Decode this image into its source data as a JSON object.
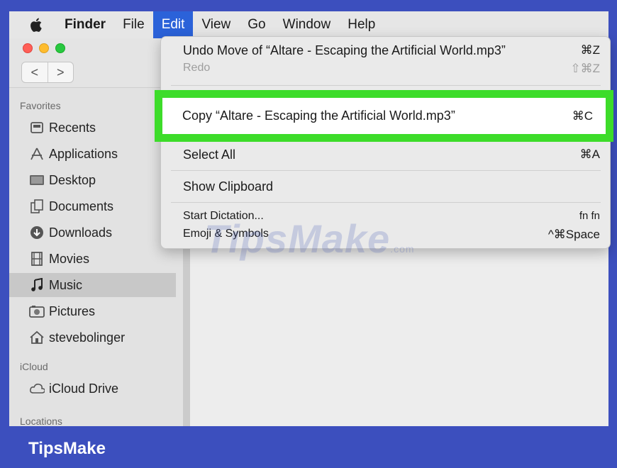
{
  "menubar": {
    "apple_icon": "apple-icon",
    "items": [
      "Finder",
      "File",
      "Edit",
      "View",
      "Go",
      "Window",
      "Help"
    ],
    "active_item": "Edit"
  },
  "window": {
    "nav": {
      "back": "<",
      "forward": ">"
    }
  },
  "sidebar": {
    "favorites_label": "Favorites",
    "favorites": [
      {
        "label": "Recents",
        "icon": "recents-icon"
      },
      {
        "label": "Applications",
        "icon": "applications-icon"
      },
      {
        "label": "Desktop",
        "icon": "desktop-icon"
      },
      {
        "label": "Documents",
        "icon": "documents-icon"
      },
      {
        "label": "Downloads",
        "icon": "downloads-icon"
      },
      {
        "label": "Movies",
        "icon": "movies-icon"
      },
      {
        "label": "Music",
        "icon": "music-icon"
      },
      {
        "label": "Pictures",
        "icon": "pictures-icon"
      },
      {
        "label": "stevebolinger",
        "icon": "home-icon"
      }
    ],
    "selected": "Music",
    "icloud_label": "iCloud",
    "icloud": [
      {
        "label": "iCloud Drive",
        "icon": "cloud-icon"
      }
    ],
    "locations_label": "Locations"
  },
  "edit_menu": {
    "undo": {
      "label": "Undo Move of “Altare - Escaping the Artificial World.mp3”",
      "shortcut": "⌘Z"
    },
    "redo": {
      "label": "Redo",
      "shortcut": "⇧⌘Z"
    },
    "copy": {
      "label": "Copy “Altare - Escaping the Artificial World.mp3”",
      "shortcut": "⌘C"
    },
    "select_all": {
      "label": "Select All",
      "shortcut": "⌘A"
    },
    "show_clipboard": {
      "label": "Show Clipboard"
    },
    "dictation": {
      "label": "Start Dictation...",
      "shortcut": "fn fn"
    },
    "emoji": {
      "label": "Emoji & Symbols",
      "shortcut": "^⌘Space"
    }
  },
  "watermark": {
    "text": "TipsMake",
    "suffix": ".com"
  },
  "banner": {
    "brand": "TipsMake"
  },
  "colors": {
    "frame": "#3c4fbe",
    "highlight": "#3ddc2a",
    "menu_active": "#2b62d9"
  }
}
